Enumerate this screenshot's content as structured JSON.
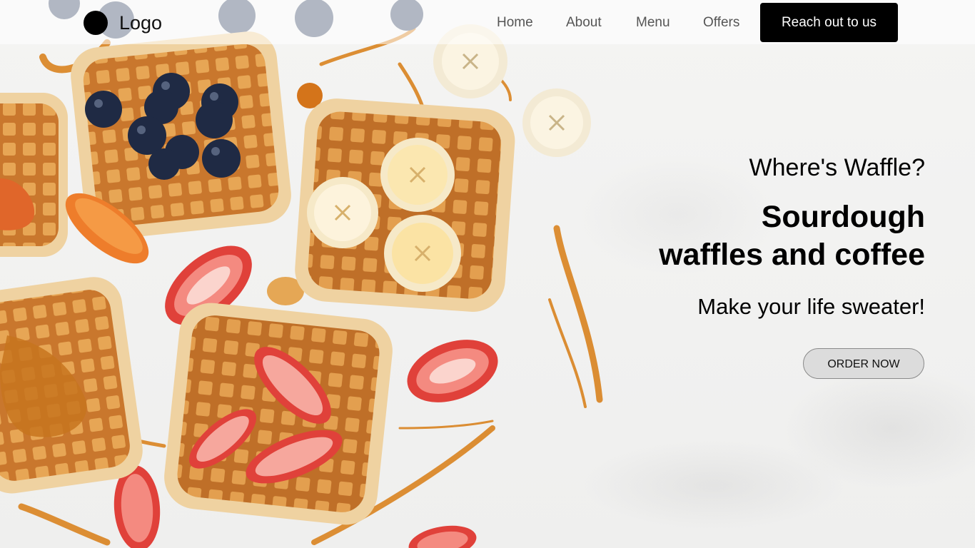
{
  "nav": {
    "logo_text": "Logo",
    "links": [
      "Home",
      "About",
      "Menu",
      "Offers"
    ],
    "cta_label": "Reach out to us"
  },
  "hero": {
    "tagline": "Where's Waffle?",
    "headline_line1": "Sourdough",
    "headline_line2": "waffles and coffee",
    "subtitle": "Make your life sweater!",
    "order_label": "ORDER NOW"
  },
  "colors": {
    "cta_background": "#000000",
    "cta_text": "#ffffff",
    "order_button_background": "#dcdcdc",
    "background": "#f1f1f0"
  },
  "icons": [
    "logo-dot-icon"
  ]
}
